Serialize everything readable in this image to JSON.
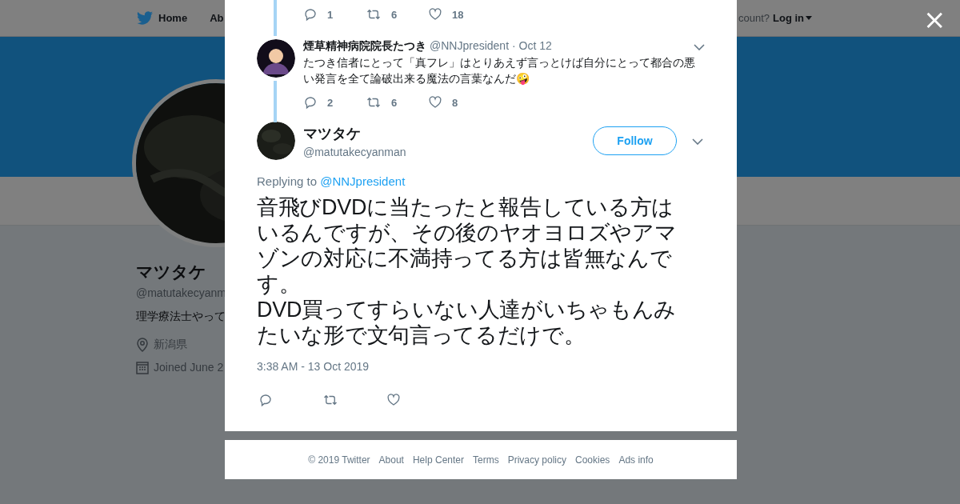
{
  "nav": {
    "items": [
      {
        "label": "Home",
        "kind": "home"
      },
      {
        "label": "Ab",
        "kind": "plain"
      }
    ],
    "account_prompt": "count?",
    "login": "Log in"
  },
  "profile": {
    "name": "マツタケ",
    "handle": "@matutakecyanm",
    "bio": "理学療法士やって",
    "location": "新潟県",
    "joined": "Joined June 2"
  },
  "parent_actions": [
    {
      "kind": "reply",
      "count": "1"
    },
    {
      "kind": "retweet",
      "count": "6"
    },
    {
      "kind": "like",
      "count": "18"
    }
  ],
  "reply": {
    "name": "煙草精神病院院長たつき",
    "handle": "@NNJpresident",
    "date": "· Oct 12",
    "text": "たつき信者にとって「真フレ」はとりあえず言っとけば自分にとって都合の悪い発言を全て論破出来る魔法の言葉なんだ🤪",
    "actions": [
      {
        "kind": "reply",
        "count": "2"
      },
      {
        "kind": "retweet",
        "count": "6"
      },
      {
        "kind": "like",
        "count": "8"
      }
    ]
  },
  "tweet": {
    "name": "マツタケ",
    "handle": "@matutakecyanman",
    "follow": "Follow",
    "replying_label": "Replying to",
    "replying_to": "@NNJpresident",
    "text": "音飛びDVDに当たったと報告している方はいるんですが、その後のヤオヨロズやアマゾンの対応に不満持ってる方は皆無なんです。\nDVD買ってすらいない人達がいちゃもんみたいな形で文句言ってるだけで。",
    "time": "3:38 AM - 13 Oct 2019",
    "actions": [
      {
        "kind": "reply"
      },
      {
        "kind": "retweet"
      },
      {
        "kind": "like"
      }
    ]
  },
  "footer": [
    "© 2019 Twitter",
    "About",
    "Help Center",
    "Terms",
    "Privacy policy",
    "Cookies",
    "Ads info"
  ],
  "close": "×"
}
